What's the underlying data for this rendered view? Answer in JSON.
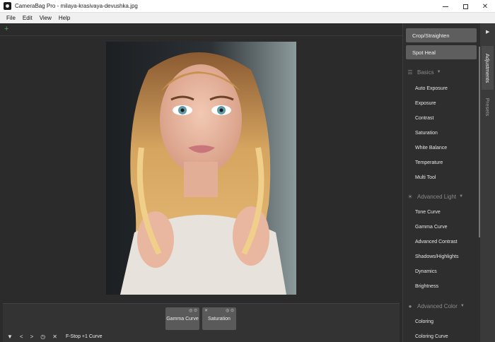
{
  "window": {
    "title": "CameraBag Pro - milaya-krasivaya-devushka.jpg",
    "controls": [
      "minimize-icon",
      "maximize-icon",
      "close-icon"
    ],
    "close_glyph": "✕"
  },
  "menu": {
    "file": "File",
    "edit": "Edit",
    "view": "View",
    "help": "Help"
  },
  "toolbar": {
    "add_glyph": "+"
  },
  "layers": {
    "gamma_curve": "Gamma Curve",
    "saturation": "Saturation",
    "card_icons": "◎ ⊙"
  },
  "bottom_bar": {
    "glyphs": [
      "▼",
      "<",
      ">",
      "◷",
      "✕"
    ],
    "preset_name": "F-Stop +1 Curve"
  },
  "sidebar": {
    "crop_button": "Crop/Straighten",
    "spot_heal_button": "Spot Heal",
    "basics": {
      "heading": "Basics",
      "items": [
        "Auto Exposure",
        "Exposure",
        "Contrast",
        "Saturation",
        "White Balance",
        "Temperature",
        "Multi Tool"
      ]
    },
    "advanced_light": {
      "heading": "Advanced Light",
      "items": [
        "Tone Curve",
        "Gamma Curve",
        "Advanced Contrast",
        "Shadows/Highlights",
        "Dynamics",
        "Brightness"
      ]
    },
    "advanced_color": {
      "heading": "Advanced Color",
      "items": [
        "Coloring",
        "Coloring Curve"
      ]
    }
  },
  "side_tabs": {
    "collapse_glyph": "▶",
    "adjustments": "Adjustments",
    "presets": "Presets"
  },
  "colors": {
    "background": "#2b2b2b",
    "panel": "#2e2e2e",
    "button": "#5e5e5e",
    "accent_add": "#5aa05a"
  }
}
